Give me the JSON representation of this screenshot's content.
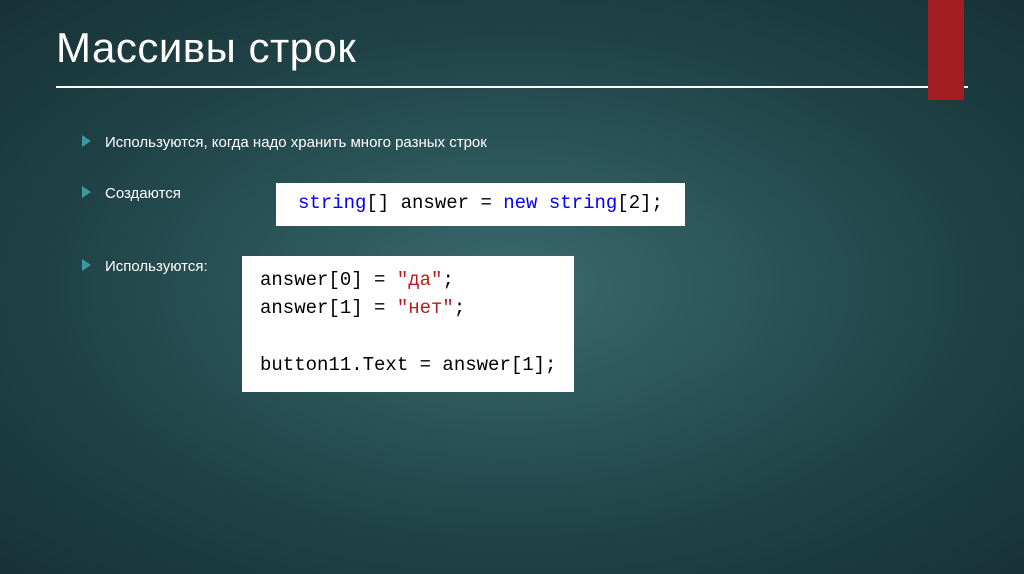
{
  "title": "Массивы строк",
  "bullets": {
    "b1": "Используются, когда надо хранить много разных строк",
    "b2": "Создаются",
    "b3": "Используются:"
  },
  "code1": {
    "t1": "string",
    "t2": "[] answer = ",
    "t3": "new",
    "t4": " ",
    "t5": "string",
    "t6": "[2];"
  },
  "code2": {
    "l1a": "answer[0] = ",
    "l1b": "\"да\"",
    "l1c": ";",
    "l2a": "answer[1] = ",
    "l2b": "\"нет\"",
    "l2c": ";",
    "l3a": "button11.Text = answer[1];"
  }
}
